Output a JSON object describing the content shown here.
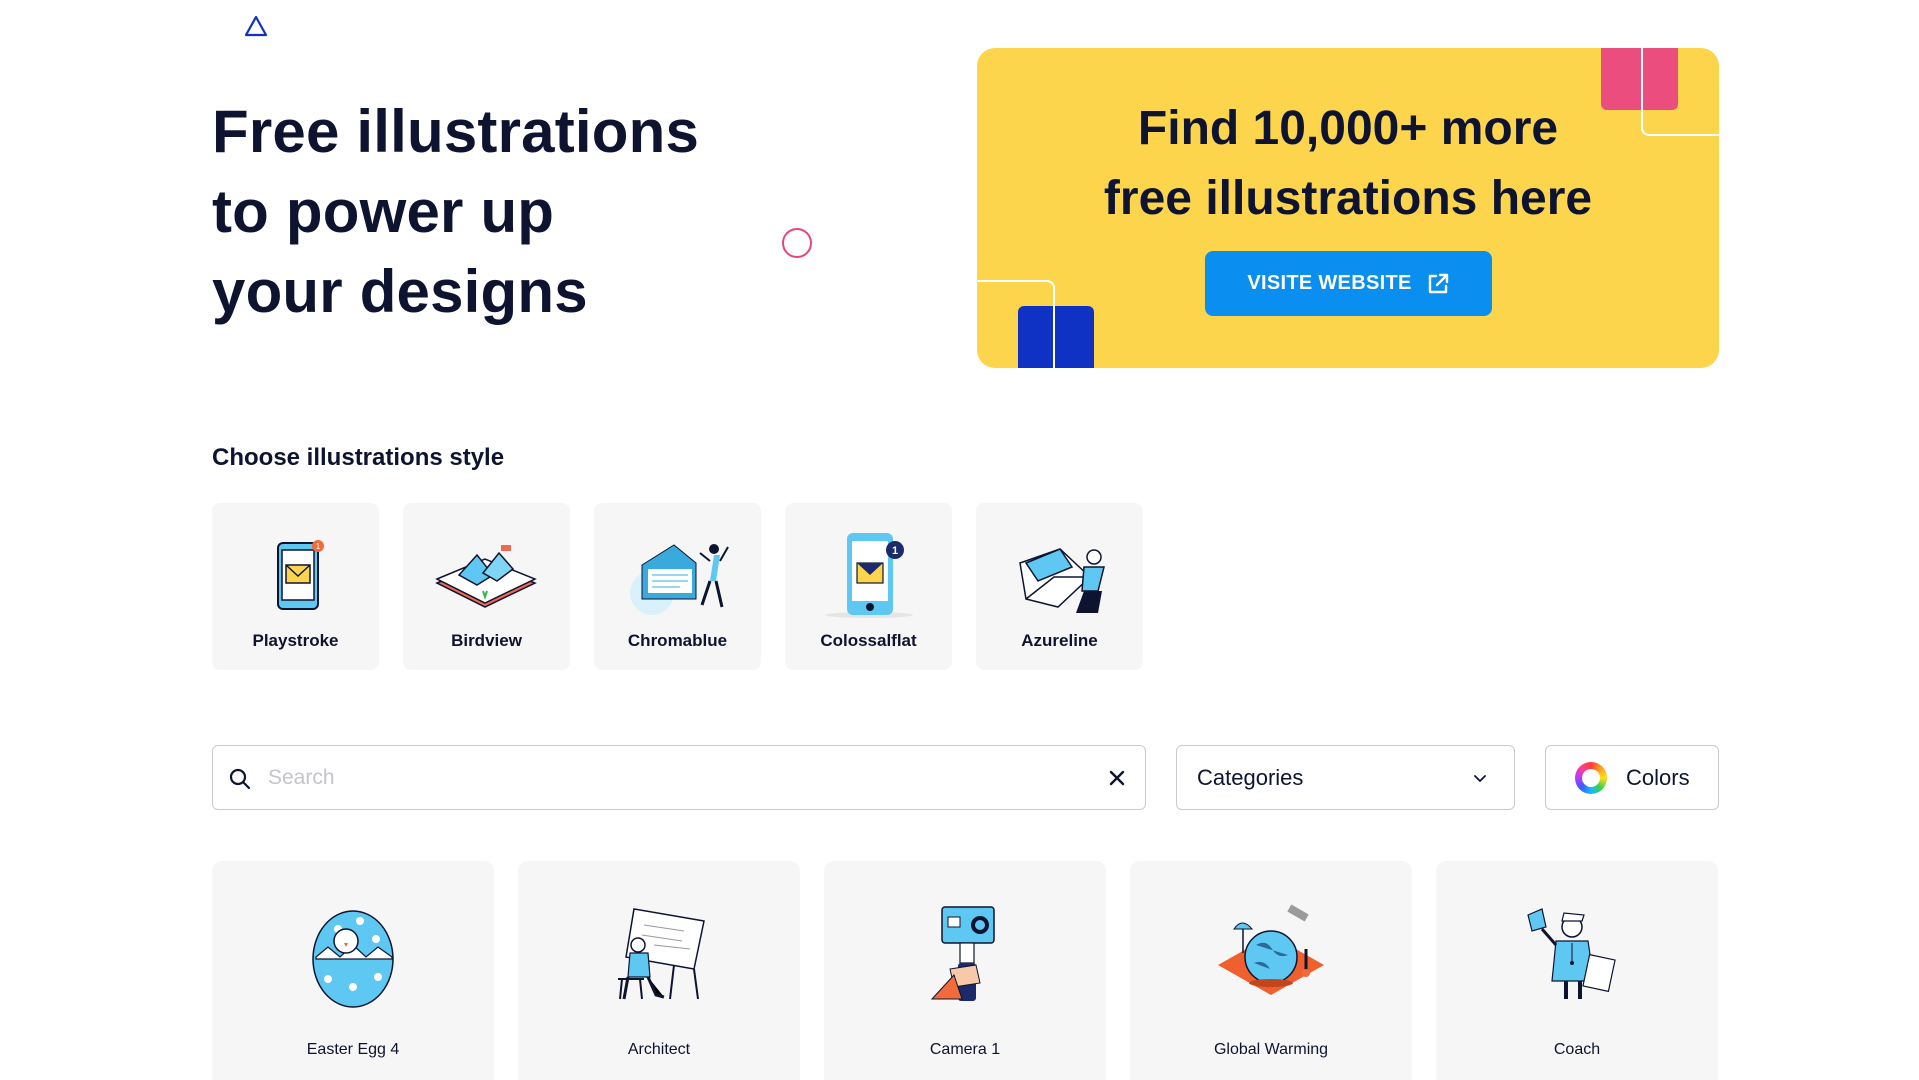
{
  "hero": {
    "title_lines": [
      "Free illustrations",
      "to power up",
      "your designs"
    ]
  },
  "promo": {
    "title_lines": [
      "Find 10,000+ more",
      "free illustrations here"
    ],
    "button_label": "VISITE WEBSITE",
    "bg_color": "#fdd54c",
    "button_color": "#0a8ef0"
  },
  "styles": {
    "heading": "Choose illustrations style",
    "items": [
      {
        "label": "Playstroke",
        "icon": "phone-envelope-icon"
      },
      {
        "label": "Birdview",
        "icon": "isometric-envelope-icon"
      },
      {
        "label": "Chromablue",
        "icon": "envelope-person-icon"
      },
      {
        "label": "Colossalflat",
        "icon": "phone-notification-icon"
      },
      {
        "label": "Azureline",
        "icon": "envelope-person-outline-icon"
      }
    ]
  },
  "filters": {
    "search_placeholder": "Search",
    "search_value": "",
    "categories_label": "Categories",
    "colors_label": "Colors"
  },
  "results": [
    {
      "label": "Easter Egg 4"
    },
    {
      "label": "Architect"
    },
    {
      "label": "Camera 1"
    },
    {
      "label": "Global Warming"
    },
    {
      "label": "Coach"
    }
  ]
}
